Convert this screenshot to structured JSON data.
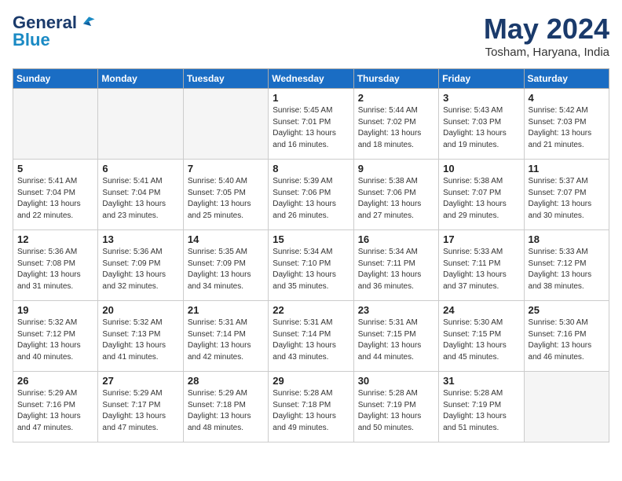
{
  "header": {
    "logo_line1": "General",
    "logo_line2": "Blue",
    "month": "May 2024",
    "location": "Tosham, Haryana, India"
  },
  "weekdays": [
    "Sunday",
    "Monday",
    "Tuesday",
    "Wednesday",
    "Thursday",
    "Friday",
    "Saturday"
  ],
  "weeks": [
    [
      {
        "num": "",
        "info": ""
      },
      {
        "num": "",
        "info": ""
      },
      {
        "num": "",
        "info": ""
      },
      {
        "num": "1",
        "info": "Sunrise: 5:45 AM\nSunset: 7:01 PM\nDaylight: 13 hours\nand 16 minutes."
      },
      {
        "num": "2",
        "info": "Sunrise: 5:44 AM\nSunset: 7:02 PM\nDaylight: 13 hours\nand 18 minutes."
      },
      {
        "num": "3",
        "info": "Sunrise: 5:43 AM\nSunset: 7:03 PM\nDaylight: 13 hours\nand 19 minutes."
      },
      {
        "num": "4",
        "info": "Sunrise: 5:42 AM\nSunset: 7:03 PM\nDaylight: 13 hours\nand 21 minutes."
      }
    ],
    [
      {
        "num": "5",
        "info": "Sunrise: 5:41 AM\nSunset: 7:04 PM\nDaylight: 13 hours\nand 22 minutes."
      },
      {
        "num": "6",
        "info": "Sunrise: 5:41 AM\nSunset: 7:04 PM\nDaylight: 13 hours\nand 23 minutes."
      },
      {
        "num": "7",
        "info": "Sunrise: 5:40 AM\nSunset: 7:05 PM\nDaylight: 13 hours\nand 25 minutes."
      },
      {
        "num": "8",
        "info": "Sunrise: 5:39 AM\nSunset: 7:06 PM\nDaylight: 13 hours\nand 26 minutes."
      },
      {
        "num": "9",
        "info": "Sunrise: 5:38 AM\nSunset: 7:06 PM\nDaylight: 13 hours\nand 27 minutes."
      },
      {
        "num": "10",
        "info": "Sunrise: 5:38 AM\nSunset: 7:07 PM\nDaylight: 13 hours\nand 29 minutes."
      },
      {
        "num": "11",
        "info": "Sunrise: 5:37 AM\nSunset: 7:07 PM\nDaylight: 13 hours\nand 30 minutes."
      }
    ],
    [
      {
        "num": "12",
        "info": "Sunrise: 5:36 AM\nSunset: 7:08 PM\nDaylight: 13 hours\nand 31 minutes."
      },
      {
        "num": "13",
        "info": "Sunrise: 5:36 AM\nSunset: 7:09 PM\nDaylight: 13 hours\nand 32 minutes."
      },
      {
        "num": "14",
        "info": "Sunrise: 5:35 AM\nSunset: 7:09 PM\nDaylight: 13 hours\nand 34 minutes."
      },
      {
        "num": "15",
        "info": "Sunrise: 5:34 AM\nSunset: 7:10 PM\nDaylight: 13 hours\nand 35 minutes."
      },
      {
        "num": "16",
        "info": "Sunrise: 5:34 AM\nSunset: 7:11 PM\nDaylight: 13 hours\nand 36 minutes."
      },
      {
        "num": "17",
        "info": "Sunrise: 5:33 AM\nSunset: 7:11 PM\nDaylight: 13 hours\nand 37 minutes."
      },
      {
        "num": "18",
        "info": "Sunrise: 5:33 AM\nSunset: 7:12 PM\nDaylight: 13 hours\nand 38 minutes."
      }
    ],
    [
      {
        "num": "19",
        "info": "Sunrise: 5:32 AM\nSunset: 7:12 PM\nDaylight: 13 hours\nand 40 minutes."
      },
      {
        "num": "20",
        "info": "Sunrise: 5:32 AM\nSunset: 7:13 PM\nDaylight: 13 hours\nand 41 minutes."
      },
      {
        "num": "21",
        "info": "Sunrise: 5:31 AM\nSunset: 7:14 PM\nDaylight: 13 hours\nand 42 minutes."
      },
      {
        "num": "22",
        "info": "Sunrise: 5:31 AM\nSunset: 7:14 PM\nDaylight: 13 hours\nand 43 minutes."
      },
      {
        "num": "23",
        "info": "Sunrise: 5:31 AM\nSunset: 7:15 PM\nDaylight: 13 hours\nand 44 minutes."
      },
      {
        "num": "24",
        "info": "Sunrise: 5:30 AM\nSunset: 7:15 PM\nDaylight: 13 hours\nand 45 minutes."
      },
      {
        "num": "25",
        "info": "Sunrise: 5:30 AM\nSunset: 7:16 PM\nDaylight: 13 hours\nand 46 minutes."
      }
    ],
    [
      {
        "num": "26",
        "info": "Sunrise: 5:29 AM\nSunset: 7:16 PM\nDaylight: 13 hours\nand 47 minutes."
      },
      {
        "num": "27",
        "info": "Sunrise: 5:29 AM\nSunset: 7:17 PM\nDaylight: 13 hours\nand 47 minutes."
      },
      {
        "num": "28",
        "info": "Sunrise: 5:29 AM\nSunset: 7:18 PM\nDaylight: 13 hours\nand 48 minutes."
      },
      {
        "num": "29",
        "info": "Sunrise: 5:28 AM\nSunset: 7:18 PM\nDaylight: 13 hours\nand 49 minutes."
      },
      {
        "num": "30",
        "info": "Sunrise: 5:28 AM\nSunset: 7:19 PM\nDaylight: 13 hours\nand 50 minutes."
      },
      {
        "num": "31",
        "info": "Sunrise: 5:28 AM\nSunset: 7:19 PM\nDaylight: 13 hours\nand 51 minutes."
      },
      {
        "num": "",
        "info": ""
      }
    ]
  ]
}
